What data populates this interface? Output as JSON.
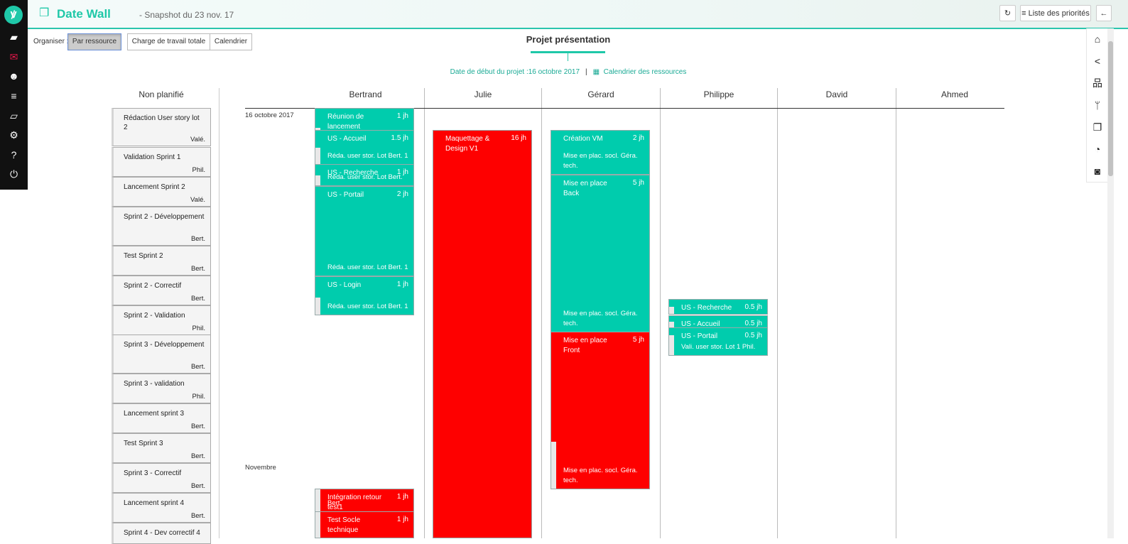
{
  "app": {
    "logo": "ꝟ",
    "title": "Date Wall",
    "subtitle": "- Snapshot du 23 nov. 17",
    "refresh_icon": "refresh-icon",
    "priorities_label": "Liste des priorités",
    "back_icon": "arrow-left-icon"
  },
  "leftnav": [
    {
      "name": "folder-icon",
      "glyph": "▰"
    },
    {
      "name": "mail-icon",
      "glyph": "✉"
    },
    {
      "name": "users-icon",
      "glyph": "☻"
    },
    {
      "name": "menu-icon",
      "glyph": "≡"
    },
    {
      "name": "map-icon",
      "glyph": "▱"
    },
    {
      "name": "settings-icon",
      "glyph": "⚙"
    },
    {
      "name": "help-icon",
      "glyph": "?"
    },
    {
      "name": "power-icon",
      "glyph": "⏻"
    }
  ],
  "organiser": {
    "label": "Organiser :",
    "by_resource": "Par ressource",
    "total_workload": "Charge de travail totale",
    "calendar": "Calendrier"
  },
  "project": {
    "title": "Projet présentation",
    "start_date": "Date de début du projet :16 octobre 2017",
    "resources_calendar": "Calendrier des ressources"
  },
  "righttools": [
    {
      "name": "home-icon",
      "glyph": "⌂"
    },
    {
      "name": "share-icon",
      "glyph": "<"
    },
    {
      "name": "hierarchy-icon",
      "glyph": "品"
    },
    {
      "name": "branch-icon",
      "glyph": "ᛘ"
    },
    {
      "name": "copy-icon",
      "glyph": "❐"
    },
    {
      "name": "dashboard-icon",
      "glyph": "◔"
    },
    {
      "name": "camera-icon",
      "glyph": "◙"
    }
  ],
  "unplanned": {
    "title": "Non planifié",
    "items": [
      {
        "title": "Rédaction User story lot 2",
        "who": "Valé."
      },
      {
        "title": "Validation Sprint 1",
        "who": "Phil."
      },
      {
        "title": "Lancement Sprint 2",
        "who": "Valé."
      },
      {
        "title": "Sprint 2 - Développement",
        "who": "Bert."
      },
      {
        "title": "Test Sprint 2",
        "who": "Bert."
      },
      {
        "title": "Sprint 2 - Correctif",
        "who": "Bert."
      },
      {
        "title": "Sprint 2 - Validation",
        "who": "Phil."
      },
      {
        "title": "Sprint 3 - Développement",
        "who": "Bert."
      },
      {
        "title": "Sprint 3 - validation",
        "who": "Phil."
      },
      {
        "title": "Lancement sprint 3",
        "who": "Bert."
      },
      {
        "title": "Test Sprint 3",
        "who": "Bert."
      },
      {
        "title": "Sprint 3 - Correctif",
        "who": "Bert."
      },
      {
        "title": "Lancement sprint 4",
        "who": "Bert."
      },
      {
        "title": "Sprint 4 - Dev correctif 4",
        "who": ""
      }
    ]
  },
  "board": {
    "columns": [
      "Bertrand",
      "Julie",
      "Gérard",
      "Philippe",
      "David",
      "Ahmed"
    ],
    "dates": [
      "16 octobre 2017",
      "Novembre"
    ]
  },
  "tasks": [
    {
      "name": "Réunion de lancement",
      "dur": "1 jh",
      "sub": "",
      "color": "teal",
      "progress": 0.9
    },
    {
      "name": "US - Accueil",
      "dur": "1.5 jh",
      "sub": "Réda. user stor. Lot Bert. 1",
      "color": "teal",
      "progress": 0.5
    },
    {
      "name": "US - Recherche",
      "dur": "1 jh",
      "sub": "Réda. user stor. Lot Bert.",
      "color": "teal",
      "progress": 0.5
    },
    {
      "name": "US - Portail",
      "dur": "2 jh",
      "sub": "Réda. user stor. Lot Bert. 1",
      "color": "teal",
      "progress": 1
    },
    {
      "name": "US - Login",
      "dur": "1 jh",
      "sub": "Réda. user stor. Lot Bert. 1",
      "color": "teal",
      "progress": 0.55
    },
    {
      "name": "Intégration retour test1",
      "dur": "1 jh",
      "sub": "Bert.",
      "color": "red",
      "progress": 0
    },
    {
      "name": "Test Socle technique",
      "dur": "1 jh",
      "sub": "",
      "color": "red",
      "progress": 0
    },
    {
      "name": "Maquettage & Design V1",
      "dur": "16 jh",
      "sub": "",
      "color": "red",
      "progress": 1
    },
    {
      "name": "Création VM",
      "dur": "2 jh",
      "sub": "Mise en plac. socl. Géra. tech.",
      "color": "teal",
      "progress": 1
    },
    {
      "name": "Mise en place Back",
      "dur": "5 jh",
      "sub": "Mise en plac. socl. Géra. tech.",
      "color": "teal",
      "progress": 1
    },
    {
      "name": "Mise en place Front",
      "dur": "5 jh",
      "sub": "Mise en plac. socl. Géra. tech.",
      "color": "red",
      "progress": 0.7
    },
    {
      "name": "US - Recherche",
      "dur": "0.5 jh",
      "sub": "",
      "color": "teal",
      "progress": 0.5
    },
    {
      "name": "US - Accueil",
      "dur": "0.5 jh",
      "sub": "",
      "color": "teal",
      "progress": 0.5
    },
    {
      "name": "US - Portail",
      "dur": "0.5 jh",
      "sub": "Vali. user stor. Lot 1 Phil.",
      "color": "teal",
      "progress": 0.25
    }
  ]
}
